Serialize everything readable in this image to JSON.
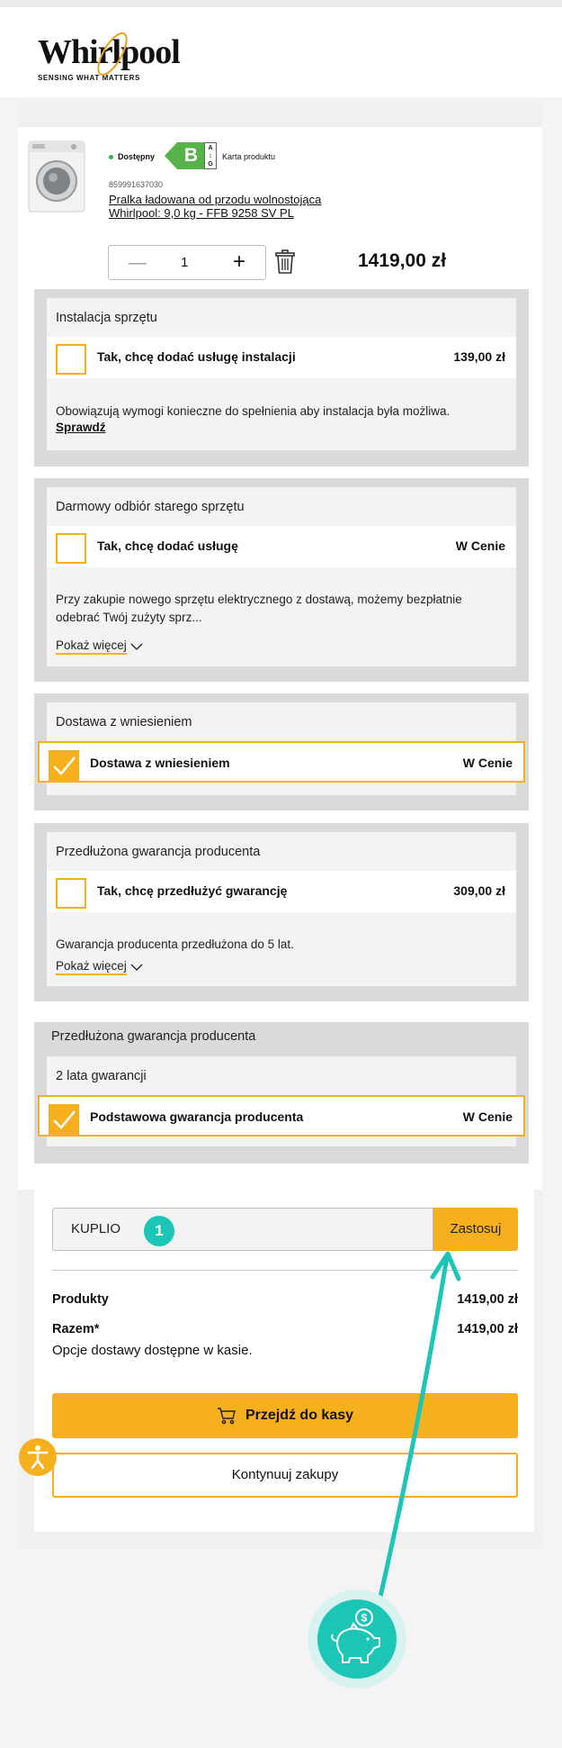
{
  "brand": {
    "name": "Whirlpool",
    "tagline": "SENSING WHAT MATTERS"
  },
  "product": {
    "availability": "Dostępny",
    "energy_class": "B",
    "energy_scale": "A G",
    "card_link": "Karta produktu",
    "sku": "859991637030",
    "name_line1": "Pralka ładowana od przodu wolnostojąca",
    "name_line2": "Whirlpool: 9,0 kg - FFB 9258 SV PL",
    "quantity": "1",
    "price": "1419,00 zł"
  },
  "sections": {
    "install": {
      "title": "Instalacja sprzętu",
      "option_label": "Tak, chcę dodać usługę instalacji",
      "option_price": "139,00 zł",
      "description": "Obowiązują wymogi konieczne do spełnienia aby instalacja była możliwa.",
      "link": "Sprawdź"
    },
    "pickup": {
      "title": "Darmowy odbiór starego sprzętu",
      "option_label": "Tak, chcę dodać usługę",
      "option_price": "W Cenie",
      "description": "Przy zakupie nowego sprzętu elektrycznego z dostawą, możemy bezpłatnie odebrać Twój zużyty sprz...",
      "more": "Pokaż więcej"
    },
    "delivery": {
      "title": "Dostawa z wniesieniem",
      "option_label": "Dostawa z wniesieniem",
      "option_price": "W Cenie",
      "checked": true
    },
    "extended_warranty": {
      "title": "Przedłużona gwarancja producenta",
      "option_label": "Tak, chcę przedłużyć gwarancję",
      "option_price": "309,00 zł",
      "description": "Gwarancja producenta przedłużona do 5 lat.",
      "more": "Pokaż więcej"
    },
    "basic_warranty": {
      "title": "Przedłużona gwarancja producenta",
      "subtitle": "2 lata gwarancji",
      "option_label": "Podstawowa gwarancja producenta",
      "option_price": "W Cenie",
      "checked": true
    }
  },
  "checkout": {
    "coupon_value": "KUPLIO",
    "coupon_badge": "1",
    "apply_label": "Zastosuj",
    "products_label": "Produkty",
    "products_value": "1419,00 zł",
    "total_label": "Razem*",
    "total_value": "1419,00 zł",
    "delivery_note": "Opcje dostawy dostępne w kasie.",
    "checkout_button": "Przejdź do kasy",
    "continue_button": "Kontynuuj zakupy"
  },
  "colors": {
    "accent": "#f6b01e",
    "teal": "#1cc6b6",
    "energy_green": "#55b347"
  },
  "icons": [
    "wheelchair-accessibility-icon",
    "piggy-bank-icon",
    "cart-icon",
    "trash-icon",
    "chevron-down-icon",
    "checkmark-icon"
  ]
}
